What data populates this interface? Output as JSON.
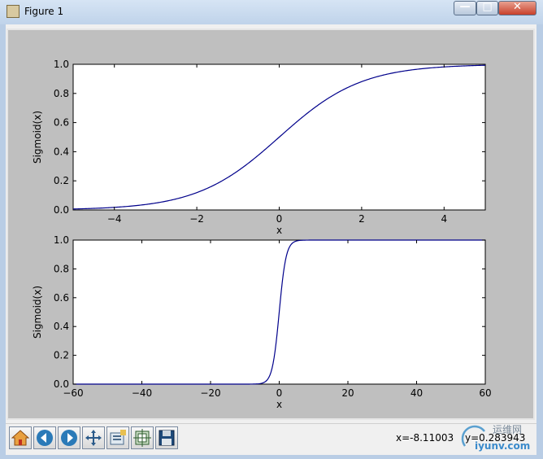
{
  "window": {
    "title": "Figure 1"
  },
  "titlebar_buttons": {
    "minimize": "—",
    "maximize": "□",
    "close": "✕"
  },
  "toolbar": {
    "icons": [
      "home-icon",
      "back-arrow-icon",
      "forward-arrow-icon",
      "pan-move-icon",
      "zoom-rect-icon",
      "subplots-config-icon",
      "save-floppy-icon"
    ],
    "coords_x": "x=-8.11003",
    "coords_y": "y=0.283943"
  },
  "watermark": {
    "text": "运维网",
    "url_text": "iyunv.com"
  },
  "colors": {
    "line": "#00008b",
    "figure_bg": "#bfbfbf"
  },
  "chart_data": [
    {
      "type": "line",
      "function": "sigmoid",
      "x_range": [
        -5,
        5
      ],
      "x": [
        -5,
        -4,
        -3,
        -2,
        -1,
        0,
        1,
        2,
        3,
        4,
        5
      ],
      "y": [
        0.0067,
        0.018,
        0.047,
        0.119,
        0.269,
        0.5,
        0.731,
        0.881,
        0.953,
        0.982,
        0.9933
      ],
      "xlabel": "x",
      "ylabel": "Sigmoid(x)",
      "xlim": [
        -5,
        5
      ],
      "ylim": [
        0.0,
        1.0
      ],
      "xticks": [
        "−4",
        "−2",
        "0",
        "2",
        "4"
      ],
      "xtick_values": [
        -4,
        -2,
        0,
        2,
        4
      ],
      "yticks": [
        "0.0",
        "0.2",
        "0.4",
        "0.6",
        "0.8",
        "1.0"
      ],
      "ytick_values": [
        0,
        0.2,
        0.4,
        0.6,
        0.8,
        1.0
      ]
    },
    {
      "type": "line",
      "function": "sigmoid",
      "x_range": [
        -60,
        60
      ],
      "x": [
        -60,
        -10,
        -6,
        -4,
        -2,
        0,
        2,
        4,
        6,
        10,
        60
      ],
      "y": [
        0.0,
        5e-05,
        0.0025,
        0.018,
        0.119,
        0.5,
        0.881,
        0.982,
        0.9975,
        0.99995,
        1.0
      ],
      "xlabel": "x",
      "ylabel": "Sigmoid(x)",
      "xlim": [
        -60,
        60
      ],
      "ylim": [
        0.0,
        1.0
      ],
      "xticks": [
        "−60",
        "−40",
        "−20",
        "0",
        "20",
        "40",
        "60"
      ],
      "xtick_values": [
        -60,
        -40,
        -20,
        0,
        20,
        40,
        60
      ],
      "yticks": [
        "0.0",
        "0.2",
        "0.4",
        "0.6",
        "0.8",
        "1.0"
      ],
      "ytick_values": [
        0,
        0.2,
        0.4,
        0.6,
        0.8,
        1.0
      ]
    }
  ]
}
